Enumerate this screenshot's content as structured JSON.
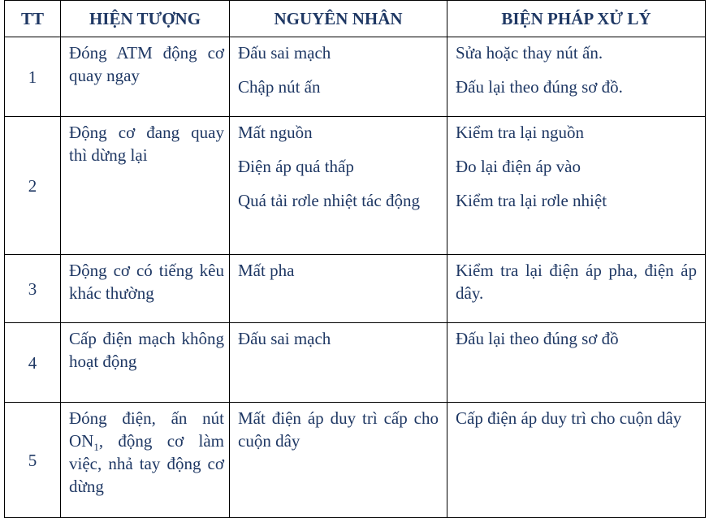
{
  "table": {
    "headers": {
      "tt": "TT",
      "symptom": "HIỆN TƯỢNG",
      "cause": "NGUYÊN NHÂN",
      "remedy": "BIỆN PHÁP XỬ LÝ"
    },
    "rows": [
      {
        "tt": "1",
        "symptom": "Đóng ATM động cơ quay ngay",
        "causes": [
          "Đấu sai mạch",
          "Chập nút ấn"
        ],
        "remedies": [
          "Sửa hoặc thay nút ấn.",
          "Đấu lại theo đúng sơ đồ."
        ]
      },
      {
        "tt": "2",
        "symptom": "Động cơ đang quay thì dừng lại",
        "causes": [
          "Mất nguồn",
          "Điện áp quá thấp",
          "Quá tải rơle nhiệt tác động"
        ],
        "remedies": [
          "Kiểm tra lại nguồn",
          "Đo lại điện áp vào",
          "Kiểm tra lại rơle nhiệt"
        ]
      },
      {
        "tt": "3",
        "symptom": "Động cơ có tiếng kêu khác thường",
        "causes": [
          "Mất pha"
        ],
        "remedies": [
          "Kiểm tra lại điện áp pha, điện áp dây."
        ]
      },
      {
        "tt": "4",
        "symptom": "Cấp điện mạch không hoạt động",
        "causes": [
          "Đấu sai mạch"
        ],
        "remedies": [
          "Đấu lại theo đúng sơ đồ"
        ]
      },
      {
        "tt": "5",
        "symptom_part1": "Đóng điện, ấn nút ON",
        "symptom_subscript": "1",
        "symptom_part2": ", động cơ làm việc, nhả tay động cơ dừng",
        "causes": [
          "Mất điện áp duy trì cấp cho cuộn dây"
        ],
        "remedies": [
          "Cấp điện áp duy trì cho cuộn dây"
        ]
      }
    ]
  }
}
